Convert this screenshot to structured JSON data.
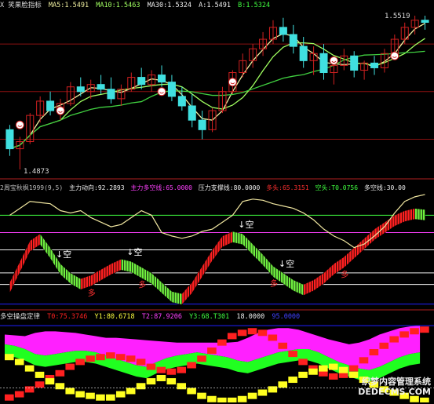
{
  "colors": {
    "background": "#000000",
    "up_candle": "#d02020",
    "down_candle": "#40e0e0",
    "ma5": "#f0f0a0",
    "ma10": "#a0ff60",
    "ma30": "#40d040",
    "grid_red": "#8a1010",
    "up_bar": "#ff2020",
    "down_bar": "#70f040",
    "fund_line": "#f0e6a0",
    "magenta": "#ff20ff",
    "yellow": "#ffff20",
    "green": "#20ff20",
    "blue": "#2020ff"
  },
  "panel1": {
    "title": "X  笑果脸指标",
    "ma5_label": "MA5:",
    "ma5_value": "1.5491",
    "ma10_label": "MA10:",
    "ma10_value": "1.5463",
    "ma30_label": "MA30:",
    "ma30_value": "1.5324",
    "a_label": "A:",
    "a_value": "1.5491",
    "b_label": "B:",
    "b_value": "1.5324",
    "high_label": "1.5519",
    "low_label": "1.4873"
  },
  "panel2": {
    "title": "2周宝秋枫1999(9,5)",
    "main_label": "主力动向:",
    "main_value": "92.2893",
    "ls_label": "主力多空线:",
    "ls_value": "65.0000",
    "support_label": "压力支撑线:",
    "support_value": "80.0000",
    "long_label": "多头:",
    "long_value": "65.3151",
    "short_label": "空头:",
    "short_value": "T0.0756",
    "ls2_label": "多空线:",
    "ls2_value": "30.00",
    "sell_mark": "↓空",
    "buy_mark": "多"
  },
  "panel3": {
    "title": "多空操盘定律",
    "t0_label": "T0:",
    "t0_value": "75.3746",
    "y1_label": "Y1:",
    "y1_value": "80.6718",
    "t2_label": "T2:",
    "t2_value": "87.9206",
    "y3_label": "Y3:",
    "y3_value": "68.T301",
    "v4_value": "18.0000",
    "v5_value": "95.0000"
  },
  "watermark": {
    "line1": "织梦内容管理系统",
    "line2": "DEDECMS.COM"
  },
  "chart_data": [
    {
      "type": "candlestick",
      "title": "笑果脸指标",
      "ylim": [
        1.4873,
        1.5519
      ],
      "candles": [
        [
          1.504,
          1.506,
          1.493,
          1.496
        ],
        [
          1.496,
          1.501,
          1.4873,
          1.499
        ],
        [
          1.499,
          1.511,
          1.498,
          1.51
        ],
        [
          1.51,
          1.518,
          1.507,
          1.516
        ],
        [
          1.516,
          1.52,
          1.51,
          1.512
        ],
        [
          1.512,
          1.517,
          1.508,
          1.515
        ],
        [
          1.515,
          1.524,
          1.514,
          1.522
        ],
        [
          1.522,
          1.526,
          1.518,
          1.52
        ],
        [
          1.52,
          1.525,
          1.517,
          1.523
        ],
        [
          1.523,
          1.527,
          1.519,
          1.521
        ],
        [
          1.521,
          1.526,
          1.515,
          1.517
        ],
        [
          1.517,
          1.523,
          1.514,
          1.521
        ],
        [
          1.521,
          1.528,
          1.52,
          1.526
        ],
        [
          1.526,
          1.53,
          1.521,
          1.523
        ],
        [
          1.523,
          1.529,
          1.52,
          1.527
        ],
        [
          1.527,
          1.531,
          1.522,
          1.524
        ],
        [
          1.524,
          1.527,
          1.516,
          1.518
        ],
        [
          1.518,
          1.522,
          1.512,
          1.514
        ],
        [
          1.514,
          1.519,
          1.505,
          1.508
        ],
        [
          1.508,
          1.512,
          1.5,
          1.504
        ],
        [
          1.504,
          1.513,
          1.503,
          1.512
        ],
        [
          1.512,
          1.522,
          1.511,
          1.52
        ],
        [
          1.52,
          1.529,
          1.519,
          1.528
        ],
        [
          1.528,
          1.536,
          1.526,
          1.533
        ],
        [
          1.533,
          1.54,
          1.53,
          1.538
        ],
        [
          1.538,
          1.545,
          1.535,
          1.542
        ],
        [
          1.542,
          1.55,
          1.54,
          1.547
        ],
        [
          1.547,
          1.551,
          1.541,
          1.544
        ],
        [
          1.544,
          1.548,
          1.536,
          1.539
        ],
        [
          1.539,
          1.543,
          1.53,
          1.533
        ],
        [
          1.533,
          1.539,
          1.527,
          1.536
        ],
        [
          1.536,
          1.54,
          1.525,
          1.528
        ],
        [
          1.528,
          1.534,
          1.523,
          1.531
        ],
        [
          1.531,
          1.538,
          1.529,
          1.535
        ],
        [
          1.535,
          1.537,
          1.526,
          1.529
        ],
        [
          1.529,
          1.533,
          1.525,
          1.532
        ],
        [
          1.532,
          1.535,
          1.527,
          1.53
        ],
        [
          1.53,
          1.538,
          1.528,
          1.536
        ],
        [
          1.536,
          1.544,
          1.535,
          1.542
        ],
        [
          1.542,
          1.549,
          1.54,
          1.547
        ],
        [
          1.547,
          1.5519,
          1.544,
          1.55
        ],
        [
          1.55,
          1.5519,
          1.546,
          1.5491
        ]
      ]
    },
    {
      "type": "line",
      "title": "周宝秋枫1999",
      "ylim": [
        0,
        100
      ],
      "fund_line": [
        80,
        86,
        92,
        91,
        90,
        84,
        82,
        84,
        78,
        74,
        70,
        72,
        78,
        84,
        80,
        65,
        62,
        60,
        62,
        66,
        68,
        74,
        80,
        92,
        94,
        93,
        90,
        88,
        86,
        82,
        76,
        68,
        62,
        58,
        52,
        55,
        62,
        70,
        82,
        92,
        96,
        98
      ],
      "long_short": [
        22,
        40,
        58,
        64,
        52,
        38,
        30,
        25,
        28,
        33,
        38,
        42,
        40,
        35,
        30,
        22,
        14,
        12,
        22,
        36,
        50,
        62,
        66,
        64,
        55,
        46,
        36,
        30,
        24,
        20,
        24,
        30,
        38,
        44,
        52,
        60,
        68,
        74,
        80,
        84,
        86,
        85
      ],
      "sell_marks": [
        5,
        12,
        23,
        27
      ],
      "buy_marks": [
        8,
        13,
        26,
        33
      ]
    },
    {
      "type": "area",
      "title": "多空操盘定律",
      "ylim": [
        0,
        100
      ],
      "magenta_top": [
        84,
        83,
        82,
        86,
        88,
        88,
        87,
        86,
        84,
        82,
        80,
        80,
        79,
        78,
        77,
        76,
        75,
        74,
        74,
        74,
        74,
        74,
        74,
        75,
        80,
        86,
        90,
        92,
        92,
        90,
        86,
        82,
        78,
        75,
        72,
        74,
        78,
        84,
        88,
        92,
        94,
        95
      ],
      "green_band_top": [
        72,
        70,
        66,
        60,
        58,
        60,
        62,
        64,
        64,
        62,
        58,
        54,
        50,
        46,
        44,
        50,
        55,
        58,
        60,
        62,
        60,
        58,
        56,
        52,
        50,
        54,
        58,
        62,
        64,
        66,
        66,
        62,
        56,
        50,
        46,
        42,
        40,
        44,
        50,
        56,
        60,
        62
      ],
      "red_step": [
        10,
        14,
        20,
        26,
        34,
        40,
        48,
        54,
        58,
        60,
        62,
        60,
        58,
        54,
        48,
        44,
        42,
        44,
        50,
        58,
        68,
        78,
        86,
        90,
        92,
        90,
        84,
        74,
        64,
        54,
        46,
        40,
        36,
        38,
        46,
        56,
        66,
        74,
        82,
        88,
        92,
        94
      ],
      "yellow_step": [
        60,
        54,
        46,
        38,
        30,
        24,
        18,
        14,
        12,
        10,
        10,
        14,
        18,
        24,
        30,
        34,
        30,
        24,
        18,
        12,
        8,
        6,
        6,
        8,
        12,
        16,
        20,
        26,
        32,
        38,
        42,
        46,
        48,
        44,
        38,
        32,
        26,
        20,
        16,
        12,
        8,
        6
      ]
    }
  ]
}
